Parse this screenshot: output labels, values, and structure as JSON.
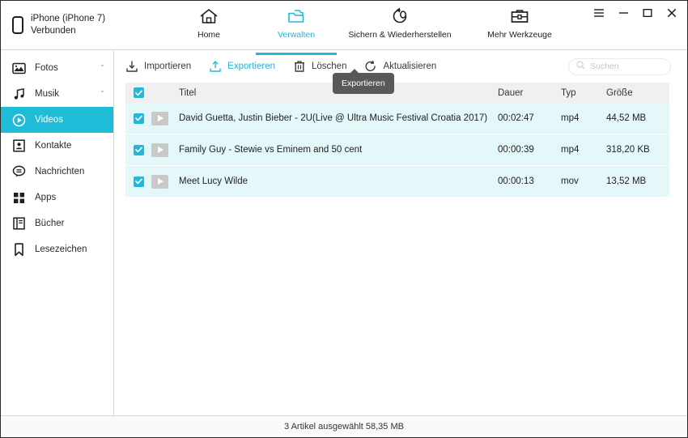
{
  "window": {
    "device_name": "iPhone (iPhone 7)",
    "device_status": "Verbunden",
    "controls": {
      "menu": "menu-icon",
      "minimize": "minimize-icon",
      "maximize": "maximize-icon",
      "close": "close-icon"
    }
  },
  "nav": {
    "tabs": [
      {
        "label": "Home",
        "icon": "home-icon",
        "active": false
      },
      {
        "label": "Verwalten",
        "icon": "folder-icon",
        "active": true
      },
      {
        "label": "Sichern & Wiederherstellen",
        "icon": "restore-icon",
        "active": false
      },
      {
        "label": "Mehr Werkzeuge",
        "icon": "toolbox-icon",
        "active": false
      }
    ]
  },
  "sidebar": {
    "items": [
      {
        "label": "Fotos",
        "icon": "photos-icon",
        "chevron": "ˇ",
        "active": false
      },
      {
        "label": "Musik",
        "icon": "music-icon",
        "chevron": "ˇ",
        "active": false
      },
      {
        "label": "Videos",
        "icon": "videos-icon",
        "chevron": "",
        "active": true
      },
      {
        "label": "Kontakte",
        "icon": "contacts-icon",
        "chevron": "",
        "active": false
      },
      {
        "label": "Nachrichten",
        "icon": "messages-icon",
        "chevron": "",
        "active": false
      },
      {
        "label": "Apps",
        "icon": "apps-icon",
        "chevron": "",
        "active": false
      },
      {
        "label": "Bücher",
        "icon": "books-icon",
        "chevron": "",
        "active": false
      },
      {
        "label": "Lesezeichen",
        "icon": "bookmarks-icon",
        "chevron": "",
        "active": false
      }
    ]
  },
  "toolbar": {
    "import_label": "Importieren",
    "export_label": "Exportieren",
    "delete_label": "Löschen",
    "refresh_label": "Aktualisieren",
    "tooltip": "Exportieren"
  },
  "search": {
    "placeholder": "Suchen",
    "value": ""
  },
  "table": {
    "columns": {
      "title": "Titel",
      "duration": "Dauer",
      "type": "Typ",
      "size": "Größe"
    },
    "rows": [
      {
        "title": "David Guetta, Justin Bieber - 2U(Live @ Ultra Music Festival Croatia 2017)",
        "duration": "00:02:47",
        "type": "mp4",
        "size": "44,52 MB",
        "checked": true
      },
      {
        "title": "Family Guy - Stewie vs Eminem and 50 cent",
        "duration": "00:00:39",
        "type": "mp4",
        "size": "318,20 KB",
        "checked": true
      },
      {
        "title": "Meet Lucy Wilde",
        "duration": "00:00:13",
        "type": "mov",
        "size": "13,52 MB",
        "checked": true
      }
    ],
    "header_checked": true
  },
  "status": {
    "text": "3 Artikel ausgewählt 58,35 MB"
  },
  "colors": {
    "accent": "#22b8d8",
    "sidebar_active": "#1fbcd8",
    "row_selected": "#e4f7f9",
    "header_row": "#f0f0f0",
    "tooltip_bg": "#595959"
  }
}
